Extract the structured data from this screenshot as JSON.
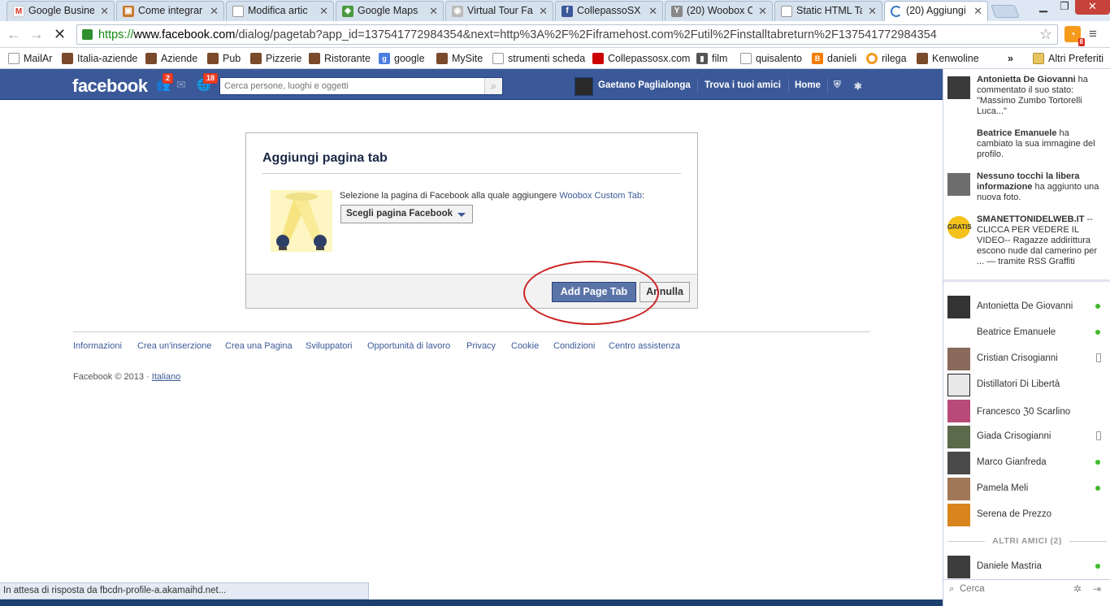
{
  "browser": {
    "tabs": [
      {
        "label": "Google Busine",
        "icon": "gmail-icon",
        "color": "#d93025"
      },
      {
        "label": "Come integrar",
        "icon": "page-icon",
        "color": "#c77b2f"
      },
      {
        "label": "Modifica artic",
        "icon": "doc-icon",
        "color": "#888888"
      },
      {
        "label": "Google Maps",
        "icon": "maps-icon",
        "color": "#4b9a3e"
      },
      {
        "label": "Virtual Tour Fa",
        "icon": "eye-icon",
        "color": "#999999"
      },
      {
        "label": "CollepassoSX",
        "icon": "facebook-icon",
        "color": "#3b5998"
      },
      {
        "label": "(20) Woobox C",
        "icon": "woobox-icon",
        "color": "#777777"
      },
      {
        "label": "Static HTML Ta",
        "icon": "doc-icon",
        "color": "#888888"
      },
      {
        "label": "(20) Aggiungi p",
        "icon": "loading-icon",
        "color": "#3b78c4"
      }
    ],
    "url_scheme": "https://",
    "url_host": "www.facebook.com",
    "url_rest": "/dialog/pagetab?app_id=137541772984354&next=http%3A%2F%2Fiframehost.com%2Futil%2Finstalltabreturn%2F137541772984354",
    "rss_badge": "8",
    "bookmarks": [
      {
        "label": "MailAr",
        "icon": "doc"
      },
      {
        "label": "Italia-aziende",
        "icon": "person"
      },
      {
        "label": "Aziende",
        "icon": "person"
      },
      {
        "label": "Pub",
        "icon": "person"
      },
      {
        "label": "Pizzerie",
        "icon": "person"
      },
      {
        "label": "Ristorante",
        "icon": "person"
      },
      {
        "label": "google",
        "icon": "google"
      },
      {
        "label": "MySite",
        "icon": "person"
      },
      {
        "label": "strumenti scheda",
        "icon": "doc"
      },
      {
        "label": "Collepassosx.com",
        "icon": "red"
      },
      {
        "label": "film",
        "icon": "film"
      },
      {
        "label": "quisalento",
        "icon": "doc"
      },
      {
        "label": "danieli",
        "icon": "blogger"
      },
      {
        "label": "rilega",
        "icon": "ring"
      },
      {
        "label": "Kenwoline",
        "icon": "person"
      }
    ],
    "more_bookmarks": "»",
    "other_bookmarks": "Altri Preferiti",
    "status_text": "In attesa di risposta da fbcdn-profile-a.akamaihd.net..."
  },
  "fb_header": {
    "logo": "facebook",
    "friend_requests": "2",
    "notifications": "18",
    "search_placeholder": "Cerca persone, luoghi e oggetti",
    "user_name": "Gaetano Paglialonga",
    "find_friends": "Trova i tuoi amici",
    "home": "Home"
  },
  "dialog": {
    "title": "Aggiungi pagina tab",
    "message": "Selezione la pagina di Facebook alla quale aggiungere ",
    "app_link": "Woobox Custom Tab",
    "message_end": ":",
    "select_label": "Scegli pagina Facebook",
    "add_button": "Add Page Tab",
    "cancel_button": "Annulla"
  },
  "footer": {
    "links": [
      "Informazioni",
      "Crea un'inserzione",
      "Crea una Pagina",
      "Sviluppatori",
      "Opportunità di lavoro",
      "Privacy",
      "Cookie",
      "Condizioni",
      "Centro assistenza"
    ],
    "copyright": "Facebook © 2013 · ",
    "language": "Italiano"
  },
  "ticker": [
    {
      "name": "Antonietta De Giovanni",
      "text": " ha commentato il suo stato: \"Massimo Zumbo Tortorelli Luca...\""
    },
    {
      "name": "Beatrice Emanuele",
      "text": " ha cambiato la sua immagine del profilo."
    },
    {
      "name": "Nessuno tocchi la libera informazione",
      "text": " ha aggiunto una nuova foto."
    },
    {
      "name": "SMANETTONIDELWEB.IT",
      "text": " -- CLICCA PER VEDERE IL VIDEO-- Ragazze addirittura escono nude dal camerino per ... — tramite RSS Graffiti",
      "pic_text": "GRATIS"
    }
  ],
  "chat": {
    "friends": [
      {
        "name": "Antonietta De Giovanni",
        "status": "online"
      },
      {
        "name": "Beatrice Emanuele",
        "status": "online"
      },
      {
        "name": "Cristian Crisogianni",
        "status": "mobile"
      },
      {
        "name": "Distillatori Di Libertà",
        "status": "none"
      },
      {
        "name": "Francesco ℨ0 Scarlino",
        "status": "none"
      },
      {
        "name": "Giada Crisogianni",
        "status": "mobile"
      },
      {
        "name": "Marco Gianfreda",
        "status": "online"
      },
      {
        "name": "Pamela Meli",
        "status": "online"
      },
      {
        "name": "Serena de Prezzo",
        "status": "none"
      }
    ],
    "other_friends": "ALTRI AMICI (2)",
    "others": [
      {
        "name": "Daniele Mastria",
        "status": "online"
      }
    ],
    "search_placeholder": "Cerca"
  }
}
